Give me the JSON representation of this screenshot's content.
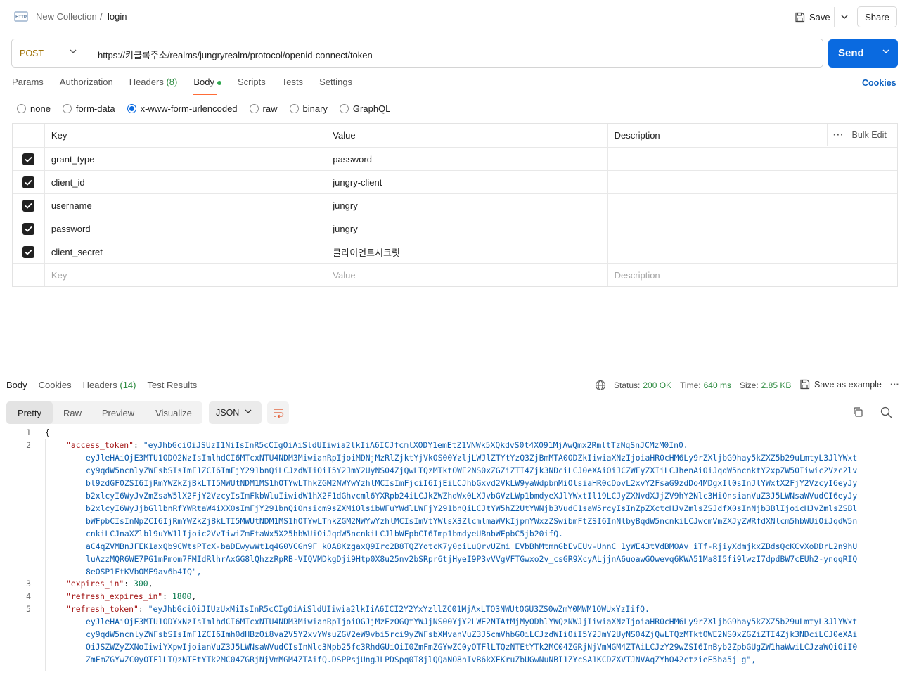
{
  "header": {
    "collection": "New Collection",
    "separator": "/",
    "request_name": "login",
    "save_label": "Save",
    "share_label": "Share"
  },
  "request": {
    "method": "POST",
    "url": "https://키클록주소/realms/jungryrealm/protocol/openid-connect/token",
    "send_label": "Send"
  },
  "tabs": {
    "params": "Params",
    "authorization": "Authorization",
    "headers": "Headers",
    "headers_count": "(8)",
    "body": "Body",
    "scripts": "Scripts",
    "tests": "Tests",
    "settings": "Settings",
    "cookies": "Cookies"
  },
  "body_types": {
    "none": "none",
    "form_data": "form-data",
    "urlencoded": "x-www-form-urlencoded",
    "raw": "raw",
    "binary": "binary",
    "graphql": "GraphQL",
    "selected": "x-www-form-urlencoded"
  },
  "table": {
    "headers": {
      "key": "Key",
      "value": "Value",
      "description": "Description",
      "bulk_edit": "Bulk Edit"
    },
    "rows": [
      {
        "key": "grant_type",
        "value": "password",
        "checked": true
      },
      {
        "key": "client_id",
        "value": "jungry-client",
        "checked": true
      },
      {
        "key": "username",
        "value": "jungry",
        "checked": true
      },
      {
        "key": "password",
        "value": "jungry",
        "checked": true
      },
      {
        "key": "client_secret",
        "value": "클라이언트시크릿",
        "checked": true
      }
    ],
    "placeholder": {
      "key": "Key",
      "value": "Value",
      "description": "Description"
    }
  },
  "response": {
    "tabs": {
      "body": "Body",
      "cookies": "Cookies",
      "headers": "Headers",
      "headers_count": "(14)",
      "test_results": "Test Results"
    },
    "status_label": "Status:",
    "status_value": "200 OK",
    "time_label": "Time:",
    "time_value": "640 ms",
    "size_label": "Size:",
    "size_value": "2.85 KB",
    "save_example": "Save as example",
    "views": {
      "pretty": "Pretty",
      "raw": "Raw",
      "preview": "Preview",
      "visualize": "Visualize"
    },
    "format": "JSON"
  },
  "code": {
    "line_numbers": [
      "1",
      "2",
      "3",
      "4",
      "5"
    ],
    "open_brace": "{",
    "access_token_key": "\"access_token\"",
    "access_token_lines": [
      "\"eyJhbGciOiJSUzI1NiIsInR5cCIgOiAiSldUIiwia2lkIiA6ICJfcmlXODY1emEtZ1VNWk5XQkdvS0t4X091MjAwQmx2RmltTzNqSnJCMzM0In0.",
      "eyJleHAiOjE3MTU1ODQ2NzIsImlhdCI6MTcxNTU4NDM3MiwianRpIjoiMDNjMzRlZjktYjVkOS00YzljLWJlZTYtYzQ3ZjBmMTA0ODZkIiwiaXNzIjoiaHR0cHM6Ly9rZXljbG9hay5kZXZ5b29uLmtyL3JlYWxt",
      "cy9qdW5ncnlyZWFsbSIsImF1ZCI6ImFjY291bnQiLCJzdWIiOiI5Y2JmY2UyNS04ZjQwLTQzMTktOWE2NS0xZGZiZTI4Zjk3NDciLCJ0eXAiOiJCZWFyZXIiLCJhenAiOiJqdW5ncnktY2xpZW50Iiwic2Vzc2lv",
      "bl9zdGF0ZSI6IjRmYWZkZjBkLTI5MWUtNDM1MS1hOTYwLThkZGM2NWYwYzhlMCIsImFjciI6IjEiLCJhbGxvd2VkLW9yaWdpbnMiOlsiaHR0cDovL2xvY2FsaG9zdDo4MDgxIl0sInJlYWxtX2FjY2VzcyI6eyJy",
      "b2xlcyI6WyJvZmZsaW5lX2FjY2VzcyIsImFkbWluIiwidW1hX2F1dGhvcml6YXRpb24iLCJkZWZhdWx0LXJvbGVzLWp1bmdyeXJlYWxtIl19LCJyZXNvdXJjZV9hY2Nlc3MiOnsianVuZ3J5LWNsaWVudCI6eyJy",
      "b2xlcyI6WyJjbGllbnRfYWRtaW4iXX0sImFjY291bnQiOnsicm9sZXMiOlsibWFuYWdlLWFjY291bnQiLCJtYW5hZ2UtYWNjb3VudC1saW5rcyIsInZpZXctcHJvZmlsZSJdfX0sInNjb3BlIjoicHJvZmlsZSBl",
      "bWFpbCIsInNpZCI6IjRmYWZkZjBkLTI5MWUtNDM1MS1hOTYwLThkZGM2NWYwYzhlMCIsImVtYWlsX3ZlcmlmaWVkIjpmYWxzZSwibmFtZSI6InNlbyBqdW5ncnkiLCJwcmVmZXJyZWRfdXNlcm5hbWUiOiJqdW5n",
      "cnkiLCJnaXZlbl9uYW1lIjoic2VvIiwiZmFtaWx5X25hbWUiOiJqdW5ncnkiLCJlbWFpbCI6Imp1bmdyeUBnbWFpbC5jb20ifQ.",
      "aC4qZVMBnJFEK1axQb9CWtsPTcX-baDEwywWt1q4G0VCGn9F_kOA8KzgaxQ9Irc2B8TQZYotcK7y0piLuQrvUZmi_EVbBhMtmnGbEvEUv-UnnC_1yWE43tVdBMOAv_iTf-RjiyXdmjkxZBdsQcKCvXoDDrL2n9hU",
      "luAzzMQR6WE7PG1mPmom7FMIdRlhrAxGG8lQhzzRpRB-VIQVMDkgDji9Htp0X8u25nv2bSRpr6tjHyeI9P3vVVgVFTGwxo2v_csGR9XcyALjjnA6uoawGOwevq6KWA51Ma8I5fi9lwzI7dpdBW7cEUh2-ynqqRIQ",
      "8eOSP1FtKVbOME9av6b4IQ\","
    ],
    "expires_in_key": "\"expires_in\"",
    "expires_in_value": "300",
    "refresh_expires_in_key": "\"refresh_expires_in\"",
    "refresh_expires_in_value": "1800",
    "refresh_token_key": "\"refresh_token\"",
    "refresh_token_lines": [
      "\"eyJhbGciOiJIUzUxMiIsInR5cCIgOiAiSldUIiwia2lkIiA6ICI2Y2YxYzllZC01MjAxLTQ3NWUtOGU3ZS0wZmY0MWM1OWUxYzIifQ.",
      "eyJleHAiOjE3MTU1ODYxNzIsImlhdCI6MTcxNTU4NDM3MiwianRpIjoiOGJjMzEzOGQtYWJjNS00YjY2LWE2NTAtMjMyODhlYWQzNWJjIiwiaXNzIjoiaHR0cHM6Ly9rZXljbG9hay5kZXZ5b29uLmtyL3JlYWxt",
      "cy9qdW5ncnlyZWFsbSIsImF1ZCI6Imh0dHBzOi8va2V5Y2xvYWsuZGV2eW9vbi5rci9yZWFsbXMvanVuZ3J5cmVhbG0iLCJzdWIiOiI5Y2JmY2UyNS04ZjQwLTQzMTktOWE2NS0xZGZiZTI4Zjk3NDciLCJ0eXAi",
      "OiJSZWZyZXNoIiwiYXpwIjoianVuZ3J5LWNsaWVudCIsInNlc3Npb25fc3RhdGUiOiI0ZmFmZGYwZC0yOTFlLTQzNTEtYTk2MC04ZGRjNjVmMGM4ZTAiLCJzY29wZSI6InByb2ZpbGUgZW1haWwiLCJzaWQiOiI0",
      "ZmFmZGYwZC0yOTFlLTQzNTEtYTk2MC04ZGRjNjVmMGM4ZTAifQ.DSPPsjUngJLPDSpq0T8jlQQaNO8nIvB6kXEKruZbUGwNuNBI1ZYcSA1KCDZXVTJNVAqZYhO42ctzieE5ba5j_g\","
    ]
  },
  "colors": {
    "accent": "#0a6ae0",
    "method": "#a0740a",
    "tab_underline": "#ff6c37",
    "status_ok": "#2c8a3f"
  },
  "icons": [
    "http-icon",
    "save-icon",
    "chevron-down-icon",
    "globe-icon",
    "copy-icon",
    "search-icon",
    "wrap-icon",
    "more-icon"
  ]
}
